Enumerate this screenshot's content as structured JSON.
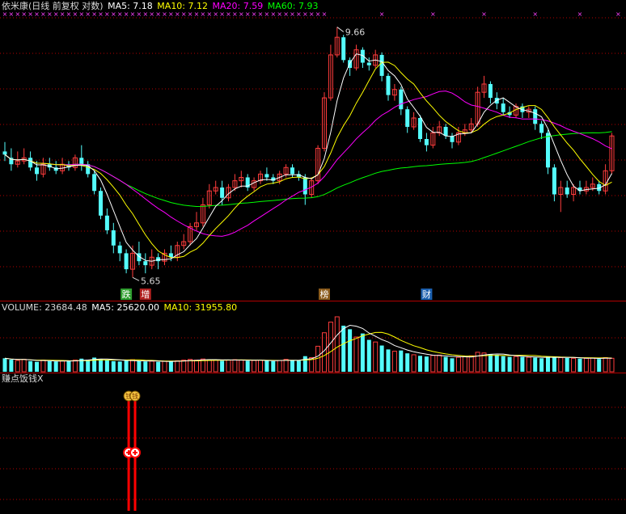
{
  "colors": {
    "background": "#000000",
    "up": "#ff3c3c",
    "down": "#54fcfc",
    "ma5": "#ffffff",
    "ma10": "#ffff00",
    "ma20": "#ff00ff",
    "ma60": "#00ff00",
    "grid": "#b40000",
    "separator": "#b40000",
    "signal": "#ff0000"
  },
  "header": {
    "title": "依米康(日线 前复权 对数)",
    "ma5": "MA5: 7.18",
    "ma10": "MA10: 7.12",
    "ma20": "MA20: 7.59",
    "ma60": "MA60: 7.93"
  },
  "volume_header": {
    "volume": "VOLUME: 23684.48",
    "ma5": "MA5: 25620.00",
    "ma10": "MA10: 31955.80"
  },
  "indicator_header": {
    "name": "赚点饭钱X"
  },
  "chart_data": {
    "type": "candlestick",
    "price_high_label": "9.66",
    "price_low_label": "5.65",
    "x_markers": [
      "跌",
      "增",
      "榜",
      "财"
    ],
    "price_ohlc": [
      [
        7.4,
        7.35,
        7.55,
        7.25
      ],
      [
        7.3,
        7.2,
        7.45,
        7.1
      ],
      [
        7.2,
        7.25,
        7.4,
        7.15
      ],
      [
        7.25,
        7.3,
        7.45,
        7.2
      ],
      [
        7.3,
        7.15,
        7.4,
        7.1
      ],
      [
        7.15,
        7.05,
        7.25,
        6.95
      ],
      [
        7.05,
        7.2,
        7.3,
        7.0
      ],
      [
        7.2,
        7.15,
        7.3,
        7.1
      ],
      [
        7.15,
        7.1,
        7.25,
        7.05
      ],
      [
        7.1,
        7.2,
        7.3,
        7.05
      ],
      [
        7.2,
        7.15,
        7.25,
        7.1
      ],
      [
        7.15,
        7.3,
        7.35,
        7.1
      ],
      [
        7.3,
        7.2,
        7.5,
        7.1
      ],
      [
        7.2,
        7.05,
        7.25,
        7.0
      ],
      [
        7.05,
        6.8,
        7.1,
        6.75
      ],
      [
        6.8,
        6.45,
        6.85,
        6.4
      ],
      [
        6.45,
        6.25,
        6.55,
        6.2
      ],
      [
        6.25,
        6.05,
        6.35,
        5.95
      ],
      [
        6.05,
        5.95,
        6.1,
        5.85
      ],
      [
        5.95,
        5.75,
        6.0,
        5.7
      ],
      [
        5.75,
        5.95,
        6.05,
        5.65
      ],
      [
        5.95,
        5.85,
        6.1,
        5.8
      ],
      [
        5.85,
        5.8,
        5.95,
        5.7
      ],
      [
        5.8,
        5.9,
        6.0,
        5.75
      ],
      [
        5.9,
        5.85,
        5.95,
        5.75
      ],
      [
        5.85,
        5.95,
        6.0,
        5.8
      ],
      [
        5.95,
        5.9,
        6.05,
        5.85
      ],
      [
        5.9,
        6.05,
        6.1,
        5.85
      ],
      [
        6.05,
        6.1,
        6.2,
        6.0
      ],
      [
        6.1,
        6.3,
        6.35,
        6.05
      ],
      [
        6.3,
        6.35,
        6.5,
        6.25
      ],
      [
        6.35,
        6.6,
        6.7,
        6.3
      ],
      [
        6.6,
        6.8,
        6.9,
        6.55
      ],
      [
        6.8,
        6.85,
        6.95,
        6.75
      ],
      [
        6.85,
        6.7,
        6.95,
        6.6
      ],
      [
        6.7,
        6.85,
        6.9,
        6.65
      ],
      [
        6.85,
        6.95,
        7.05,
        6.8
      ],
      [
        6.95,
        7.0,
        7.1,
        6.85
      ],
      [
        7.0,
        6.85,
        7.05,
        6.8
      ],
      [
        6.85,
        6.95,
        7.0,
        6.8
      ],
      [
        6.95,
        7.05,
        7.1,
        6.9
      ],
      [
        7.05,
        7.0,
        7.15,
        6.95
      ],
      [
        7.0,
        6.95,
        7.05,
        6.9
      ],
      [
        6.95,
        7.05,
        7.1,
        6.9
      ],
      [
        7.05,
        7.15,
        7.2,
        7.0
      ],
      [
        7.15,
        7.05,
        7.2,
        7.0
      ],
      [
        7.05,
        7.0,
        7.1,
        6.95
      ],
      [
        7.0,
        6.75,
        7.05,
        6.6
      ],
      [
        6.75,
        6.95,
        7.0,
        6.7
      ],
      [
        6.95,
        7.45,
        7.5,
        6.9
      ],
      [
        7.45,
        8.3,
        8.4,
        7.4
      ],
      [
        8.3,
        9.1,
        9.3,
        8.25
      ],
      [
        9.1,
        9.45,
        9.66,
        9.05
      ],
      [
        9.45,
        9.0,
        9.5,
        8.95
      ],
      [
        9.0,
        8.85,
        9.05,
        8.7
      ],
      [
        8.85,
        9.2,
        9.3,
        8.8
      ],
      [
        9.2,
        8.95,
        9.25,
        8.85
      ],
      [
        8.95,
        8.9,
        9.05,
        8.8
      ],
      [
        8.9,
        9.1,
        9.2,
        8.85
      ],
      [
        9.1,
        8.7,
        9.15,
        8.6
      ],
      [
        8.7,
        8.35,
        8.75,
        8.25
      ],
      [
        8.35,
        8.45,
        8.55,
        8.25
      ],
      [
        8.45,
        8.1,
        8.5,
        8.0
      ],
      [
        8.1,
        7.8,
        8.15,
        7.7
      ],
      [
        7.8,
        7.95,
        8.05,
        7.75
      ],
      [
        7.95,
        7.6,
        8.0,
        7.55
      ],
      [
        7.6,
        7.5,
        7.7,
        7.4
      ],
      [
        7.5,
        7.7,
        7.8,
        7.45
      ],
      [
        7.7,
        7.8,
        7.9,
        7.65
      ],
      [
        7.8,
        7.65,
        7.85,
        7.6
      ],
      [
        7.65,
        7.55,
        7.7,
        7.45
      ],
      [
        7.55,
        7.7,
        7.8,
        7.5
      ],
      [
        7.7,
        7.75,
        7.85,
        7.65
      ],
      [
        7.75,
        7.85,
        7.95,
        7.7
      ],
      [
        7.85,
        8.4,
        8.5,
        7.8
      ],
      [
        8.4,
        8.55,
        8.7,
        8.3
      ],
      [
        8.55,
        8.3,
        8.6,
        8.2
      ],
      [
        8.3,
        8.2,
        8.4,
        8.1
      ],
      [
        8.2,
        8.05,
        8.3,
        8.0
      ],
      [
        8.05,
        8.0,
        8.15,
        7.95
      ],
      [
        8.0,
        8.15,
        8.2,
        7.95
      ],
      [
        8.15,
        8.05,
        8.2,
        7.95
      ],
      [
        8.05,
        8.1,
        8.15,
        7.95
      ],
      [
        8.1,
        7.85,
        8.15,
        7.75
      ],
      [
        7.85,
        7.7,
        7.9,
        7.6
      ],
      [
        7.7,
        7.15,
        7.75,
        7.05
      ],
      [
        7.15,
        6.75,
        7.2,
        6.65
      ],
      [
        6.75,
        6.85,
        6.95,
        6.5
      ],
      [
        6.85,
        6.75,
        6.95,
        6.7
      ],
      [
        6.75,
        6.85,
        6.9,
        6.65
      ],
      [
        6.85,
        6.8,
        6.95,
        6.75
      ],
      [
        6.8,
        6.85,
        6.95,
        6.75
      ],
      [
        6.85,
        6.9,
        7.0,
        6.8
      ],
      [
        6.9,
        6.8,
        6.95,
        6.75
      ],
      [
        6.8,
        7.1,
        7.2,
        6.75
      ],
      [
        7.1,
        7.65,
        7.7,
        7.05
      ]
    ],
    "volume": [
      38,
      34,
      32,
      35,
      30,
      28,
      33,
      30,
      29,
      31,
      30,
      33,
      37,
      34,
      40,
      36,
      33,
      30,
      29,
      31,
      34,
      30,
      29,
      30,
      28,
      30,
      29,
      31,
      33,
      35,
      33,
      36,
      34,
      33,
      31,
      33,
      34,
      33,
      31,
      32,
      33,
      31,
      30,
      32,
      35,
      33,
      31,
      44,
      40,
      72,
      110,
      140,
      155,
      130,
      120,
      98,
      108,
      90,
      84,
      74,
      63,
      58,
      60,
      52,
      48,
      45,
      43,
      46,
      47,
      42,
      38,
      41,
      43,
      45,
      55,
      53,
      50,
      48,
      44,
      42,
      43,
      42,
      41,
      40,
      38,
      43,
      42,
      40,
      39,
      38,
      37,
      38,
      39,
      36,
      40,
      38
    ],
    "signal_bars": [
      {
        "index": 19,
        "label": "钱"
      },
      {
        "index": 20,
        "label": "钱"
      }
    ]
  }
}
